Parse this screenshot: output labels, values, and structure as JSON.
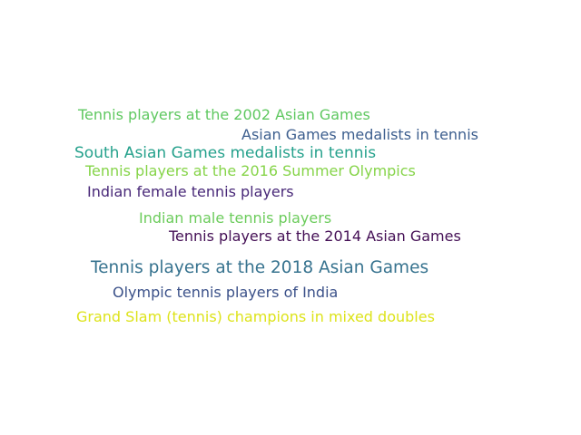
{
  "words": [
    {
      "text": "Tennis players at the 2002 Asian Games",
      "color": "#5fc860"
    },
    {
      "text": "Asian Games medalists in tennis",
      "color": "#3c5e8e"
    },
    {
      "text": "South Asian Games medalists in tennis",
      "color": "#25a18c"
    },
    {
      "text": "Tennis players at the 2016 Summer Olympics",
      "color": "#86d449"
    },
    {
      "text": "Indian female tennis players",
      "color": "#482878"
    },
    {
      "text": "Indian male tennis players",
      "color": "#6ccc5c"
    },
    {
      "text": "Tennis players at the 2014 Asian Games",
      "color": "#440f55"
    },
    {
      "text": "Tennis players at the 2018 Asian Games",
      "color": "#37738f"
    },
    {
      "text": "Olympic tennis players of India",
      "color": "#3b5189"
    },
    {
      "text": "Grand Slam (tennis) champions in mixed doubles",
      "color": "#dde31a"
    }
  ]
}
